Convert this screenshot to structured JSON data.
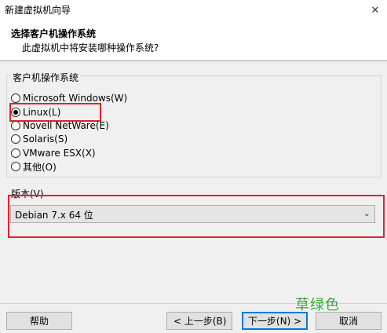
{
  "window": {
    "title": "新建虚拟机向导",
    "close_glyph": "✕"
  },
  "header": {
    "title": "选择客户机操作系统",
    "subtitle": "此虚拟机中将安装哪种操作系统?"
  },
  "guest_os": {
    "group_label": "客户机操作系统",
    "options": [
      {
        "label": "Microsoft Windows(W)",
        "checked": false
      },
      {
        "label": "Linux(L)",
        "checked": true
      },
      {
        "label": "Novell NetWare(E)",
        "checked": false
      },
      {
        "label": "Solaris(S)",
        "checked": false
      },
      {
        "label": "VMware ESX(X)",
        "checked": false
      },
      {
        "label": "其他(O)",
        "checked": false
      }
    ]
  },
  "version": {
    "label": "版本(V)",
    "selected": "Debian 7.x 64 位",
    "chevron_glyph": "⌄"
  },
  "buttons": {
    "help": "帮助",
    "back": "< 上一步(B)",
    "next": "下一步(N) >",
    "cancel": "取消"
  },
  "watermark": "草绿色",
  "colors": {
    "highlight": "#e0222c",
    "default_button": "#0078d7",
    "watermark": "#3a9b3a"
  }
}
